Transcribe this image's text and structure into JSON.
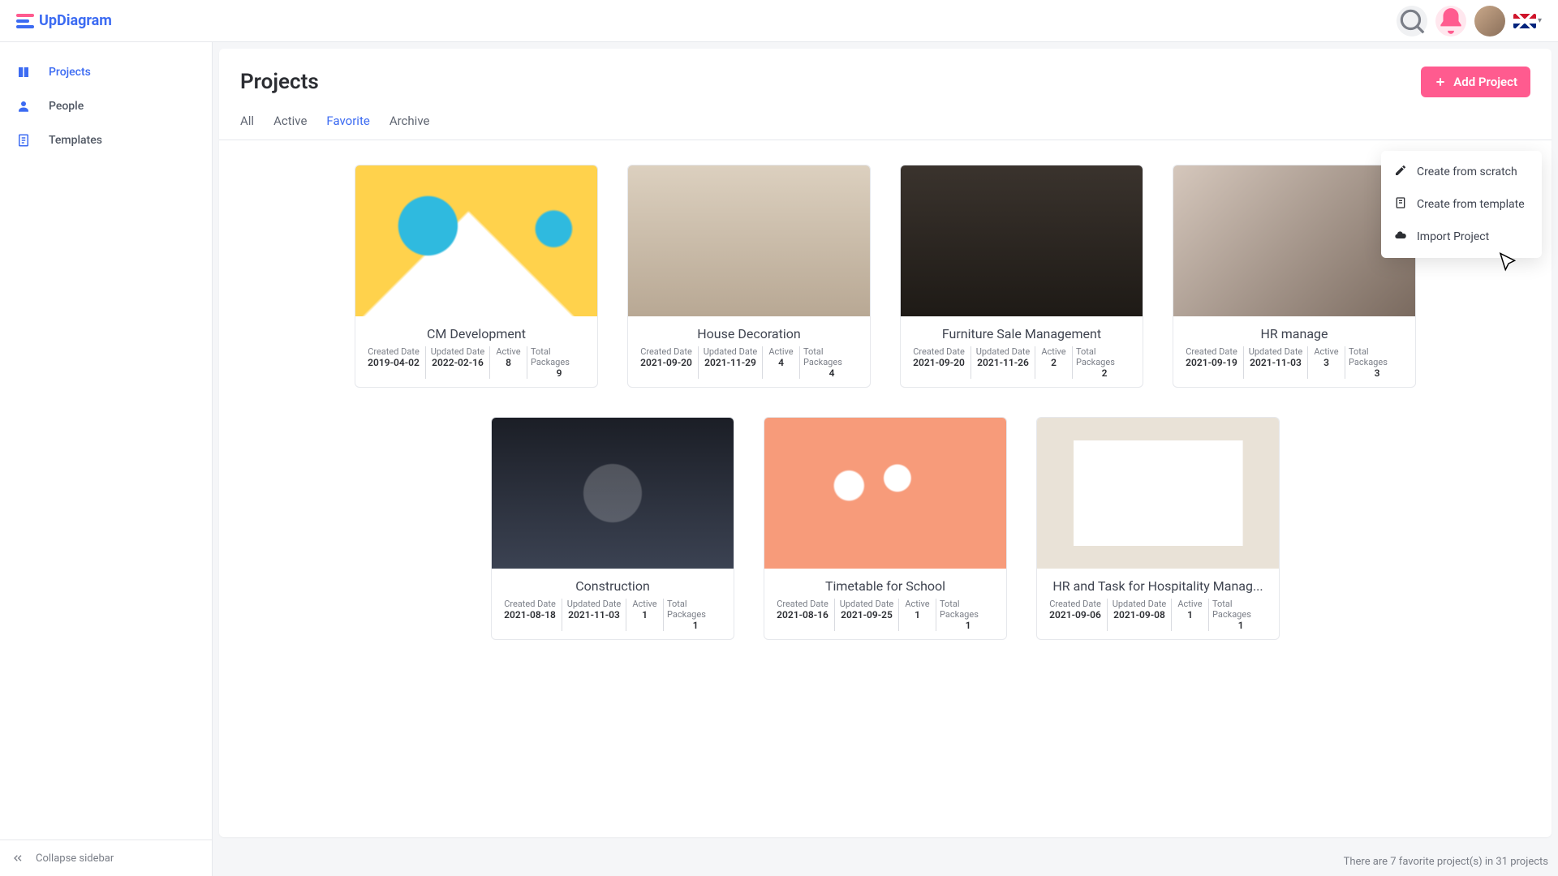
{
  "brand": "UpDiagram",
  "sidebar": {
    "items": [
      {
        "label": "Projects",
        "active": true
      },
      {
        "label": "People",
        "active": false
      },
      {
        "label": "Templates",
        "active": false
      }
    ],
    "collapse": "Collapse sidebar"
  },
  "page": {
    "title": "Projects",
    "add_btn": "Add Project"
  },
  "tabs": [
    {
      "label": "All",
      "active": false
    },
    {
      "label": "Active",
      "active": false
    },
    {
      "label": "Favorite",
      "active": true
    },
    {
      "label": "Archive",
      "active": false
    }
  ],
  "meta_labels": {
    "created": "Created Date",
    "updated": "Updated Date",
    "active": "Active",
    "total": "Total Packages"
  },
  "projects": [
    {
      "title": "CM Development",
      "created": "2019-04-02",
      "updated": "2022-02-16",
      "active": "8",
      "total": "9",
      "thumb": "th1"
    },
    {
      "title": "House Decoration",
      "created": "2021-09-20",
      "updated": "2021-11-29",
      "active": "4",
      "total": "4",
      "thumb": "th2"
    },
    {
      "title": "Furniture Sale Management",
      "created": "2021-09-20",
      "updated": "2021-11-26",
      "active": "2",
      "total": "2",
      "thumb": "th3"
    },
    {
      "title": "HR manage",
      "created": "2021-09-19",
      "updated": "2021-11-03",
      "active": "3",
      "total": "3",
      "thumb": "th4"
    },
    {
      "title": "Construction",
      "created": "2021-08-18",
      "updated": "2021-11-03",
      "active": "1",
      "total": "1",
      "thumb": "th5"
    },
    {
      "title": "Timetable for School",
      "created": "2021-08-16",
      "updated": "2021-09-25",
      "active": "1",
      "total": "1",
      "thumb": "th6"
    },
    {
      "title": "HR and Task for Hospitality Manag...",
      "created": "2021-09-06",
      "updated": "2021-09-08",
      "active": "1",
      "total": "1",
      "thumb": "th7"
    }
  ],
  "dropdown": [
    {
      "label": "Create from scratch"
    },
    {
      "label": "Create from template"
    },
    {
      "label": "Import Project"
    }
  ],
  "footer": "There are 7 favorite project(s) in 31 projects"
}
